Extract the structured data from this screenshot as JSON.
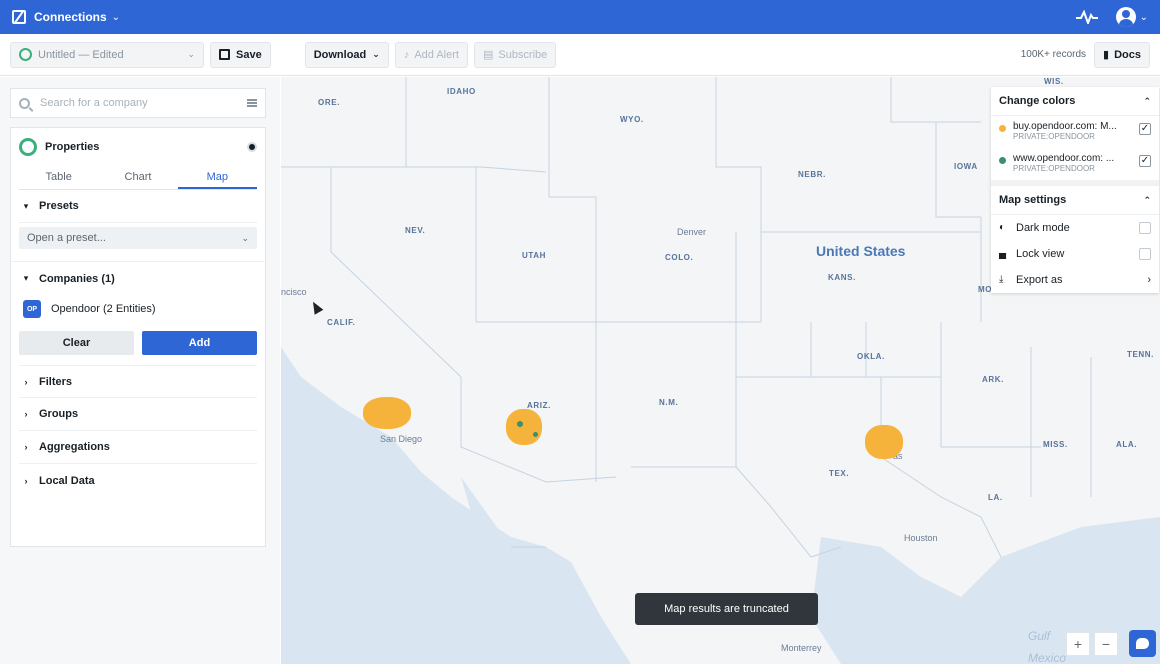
{
  "topbar": {
    "title": "Connections",
    "activity_icon": "pulse-icon",
    "user_icon": "avatar-icon"
  },
  "toolbar": {
    "file_name": "Untitled — Edited",
    "save": "Save",
    "download": "Download",
    "add_alert": "Add Alert",
    "subscribe": "Subscribe",
    "records": "100K+ records",
    "docs": "Docs"
  },
  "sidebar": {
    "search_placeholder": "Search for a company",
    "panel_title": "Properties",
    "tabs": [
      "Table",
      "Chart",
      "Map"
    ],
    "active_tab": "Map",
    "presets": {
      "title": "Presets",
      "placeholder": "Open a preset..."
    },
    "companies": {
      "title": "Companies (1)",
      "badge": "OP",
      "item": "Opendoor (2 Entities)",
      "clear": "Clear",
      "add": "Add"
    },
    "sections": [
      "Filters",
      "Groups",
      "Aggregations",
      "Local Data"
    ]
  },
  "map": {
    "state_labels": [
      "ORE.",
      "IDAHO",
      "WYO.",
      "NEV.",
      "UTAH",
      "COLO.",
      "NEBR.",
      "IOWA",
      "KANS.",
      "CALIF.",
      "ARIZ.",
      "N.M.",
      "OKLA.",
      "ARK.",
      "TENN.",
      "MISS.",
      "ALA.",
      "TEX.",
      "LA.",
      "WIS.",
      "MO"
    ],
    "city_labels": [
      "Denver",
      "San Diego",
      "Houston",
      "Monterrey",
      "ncisco",
      "as"
    ],
    "country_label": "United States",
    "water_labels": [
      "Gulf",
      "Mexico"
    ],
    "legend": {
      "change_colors": "Change colors",
      "series": [
        {
          "name": "buy.opendoor.com: M...",
          "sub": "PRIVATE:OPENDOOR",
          "color": "#f6b33b",
          "checked": "✓"
        },
        {
          "name": "www.opendoor.com: ...",
          "sub": "PRIVATE:OPENDOOR",
          "color": "#3b8f6e",
          "checked": "✓"
        }
      ]
    },
    "settings": {
      "title": "Map settings",
      "dark_mode": "Dark mode",
      "lock_view": "Lock view",
      "export_as": "Export as"
    },
    "toast": "Map results are truncated",
    "zoom_in": "+",
    "zoom_out": "−"
  }
}
